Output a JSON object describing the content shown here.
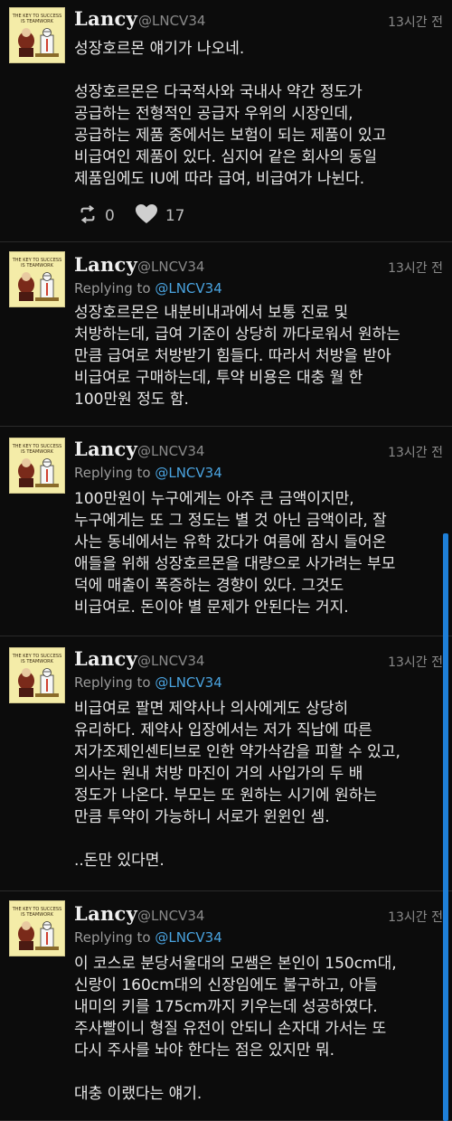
{
  "tweets": [
    {
      "name": "Lancy",
      "handle": "@LNCV34",
      "time": "13시간 전",
      "replying_prefix": "",
      "replying_mention": "",
      "lines": [
        "성장호르몬 얘기가 나오네.",
        "",
        "성장호르몬은 다국적사와 국내사 약간 정도가",
        "공급하는 전형적인 공급자 우위의 시장인데,",
        "공급하는 제품 중에서는 보험이 되는 제품이 있고",
        "비급여인 제품이 있다. 심지어 같은 회사의 동일",
        "제품임에도 IU에 따라 급여, 비급여가 나뉜다."
      ],
      "retweets": "0",
      "likes": "17"
    },
    {
      "name": "Lancy",
      "handle": "@LNCV34",
      "time": "13시간 전",
      "replying_prefix": "Replying to ",
      "replying_mention": "@LNCV34",
      "lines": [
        "성장호르몬은 내분비내과에서 보통 진료 및",
        "처방하는데, 급여 기준이 상당히 까다로워서 원하는",
        "만큼 급여로 처방받기 힘들다. 따라서 처방을 받아",
        "비급여로 구매하는데, 투약 비용은 대충 월 한",
        "100만원 정도 함."
      ]
    },
    {
      "name": "Lancy",
      "handle": "@LNCV34",
      "time": "13시간 전",
      "replying_prefix": "Replying to ",
      "replying_mention": "@LNCV34",
      "lines": [
        "100만원이 누구에게는 아주 큰 금액이지만,",
        "누구에게는 또 그 정도는 별 것 아닌 금액이라, 잘",
        "사는 동네에서는 유학 갔다가 여름에 잠시 들어온",
        "애들을 위해 성장호르몬을 대량으로 사가려는 부모",
        "덕에 매출이 폭증하는 경향이 있다. 그것도",
        "비급여로. 돈이야 별 문제가 안된다는 거지."
      ]
    },
    {
      "name": "Lancy",
      "handle": "@LNCV34",
      "time": "13시간 전",
      "replying_prefix": "Replying to ",
      "replying_mention": "@LNCV34",
      "lines": [
        "비급여로 팔면 제약사나 의사에게도 상당히",
        "유리하다. 제약사 입장에서는 저가 직납에 따른",
        "저가조제인센티브로 인한 약가삭감을 피할 수 있고,",
        "의사는 원내 처방 마진이 거의 사입가의 두 배",
        "정도가 나온다. 부모는 또 원하는 시기에 원하는",
        "만큼 투약이 가능하니 서로가 윈윈인 셈.",
        "",
        "..돈만 있다면."
      ]
    },
    {
      "name": "Lancy",
      "handle": "@LNCV34",
      "time": "13시간 전",
      "replying_prefix": "Replying to ",
      "replying_mention": "@LNCV34",
      "lines": [
        "이 코스로 분당서울대의 모쌤은 본인이 150cm대,",
        "신랑이 160cm대의 신장임에도 불구하고, 아들",
        "내미의 키를 175cm까지 키우는데 성공하였다.",
        "주사빨이니 형질 유전이 안되니 손자대 가서는 또",
        "다시 주사를 놔야 한다는 점은 있지만 뭐.",
        "",
        "대충 이랬다는 얘기."
      ]
    }
  ]
}
